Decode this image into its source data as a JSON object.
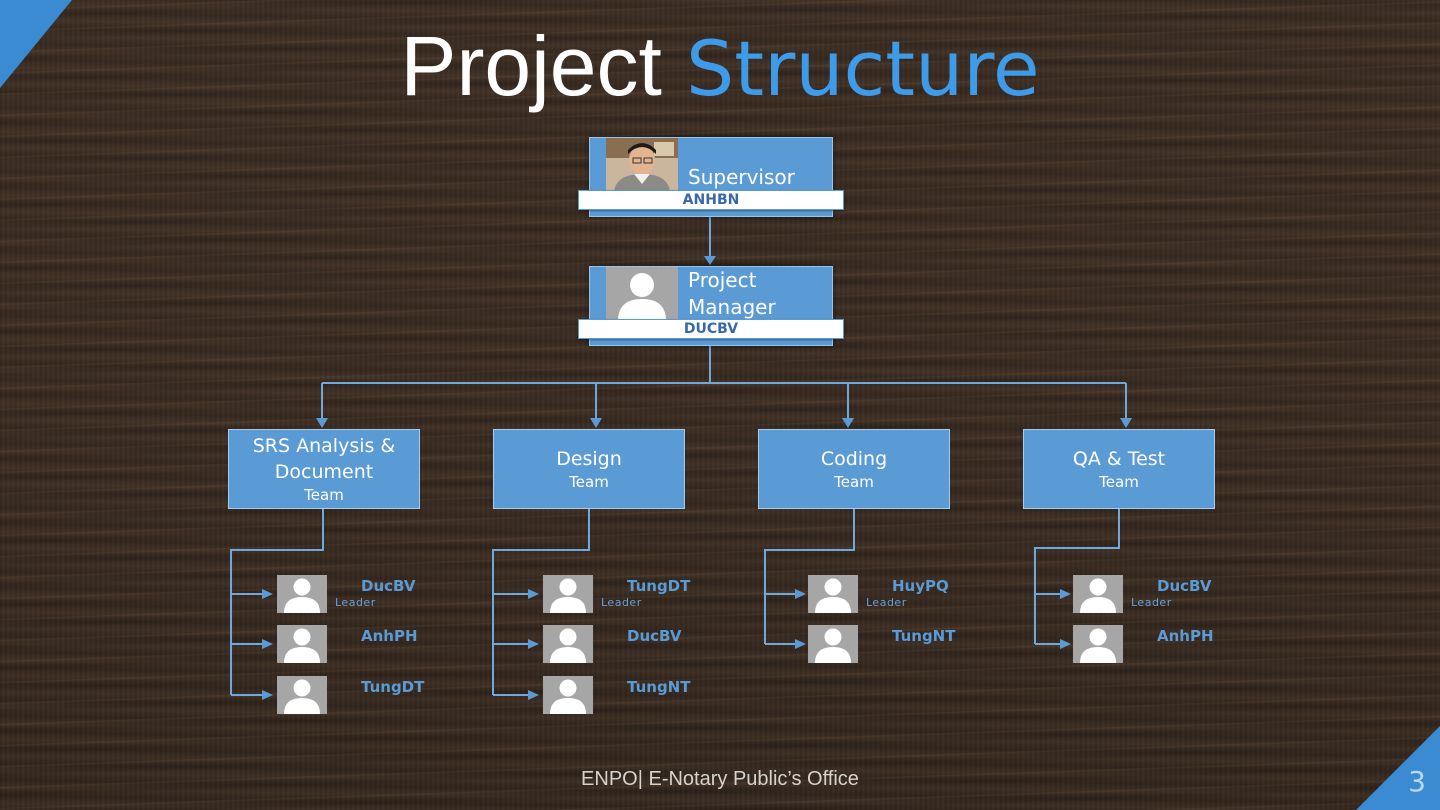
{
  "slide": {
    "title_part1": "Project",
    "title_part2": "Structure",
    "footer": "ENPO| E-Notary Public’s Office",
    "page_number": "3",
    "colors": {
      "accent": "#3d9be9",
      "box": "#5b9bd5",
      "corner": "#3a8bd2",
      "name_text": "#3868a8"
    }
  },
  "supervisor": {
    "role": "Supervisor",
    "name": "ANHBN",
    "avatar": "photo-portrait"
  },
  "manager": {
    "role_line1": "Project",
    "role_line2": "Manager",
    "name": "DUCBV",
    "avatar": "person-icon"
  },
  "teams": [
    {
      "name_line1": "SRS Analysis &",
      "name_line2": "Document",
      "sub": "Team",
      "members": [
        {
          "name": "DucBV",
          "role": "Leader"
        },
        {
          "name": "AnhPH",
          "role": ""
        },
        {
          "name": "TungDT",
          "role": ""
        }
      ]
    },
    {
      "name_line1": "Design",
      "name_line2": "",
      "sub": "Team",
      "members": [
        {
          "name": "TungDT",
          "role": "Leader"
        },
        {
          "name": "DucBV",
          "role": ""
        },
        {
          "name": "TungNT",
          "role": ""
        }
      ]
    },
    {
      "name_line1": "Coding",
      "name_line2": "",
      "sub": "Team",
      "members": [
        {
          "name": "HuyPQ",
          "role": "Leader"
        },
        {
          "name": "TungNT",
          "role": ""
        }
      ]
    },
    {
      "name_line1": "QA & Test",
      "name_line2": "",
      "sub": "Team",
      "members": [
        {
          "name": "DucBV",
          "role": "Leader"
        },
        {
          "name": "AnhPH",
          "role": ""
        }
      ]
    }
  ]
}
